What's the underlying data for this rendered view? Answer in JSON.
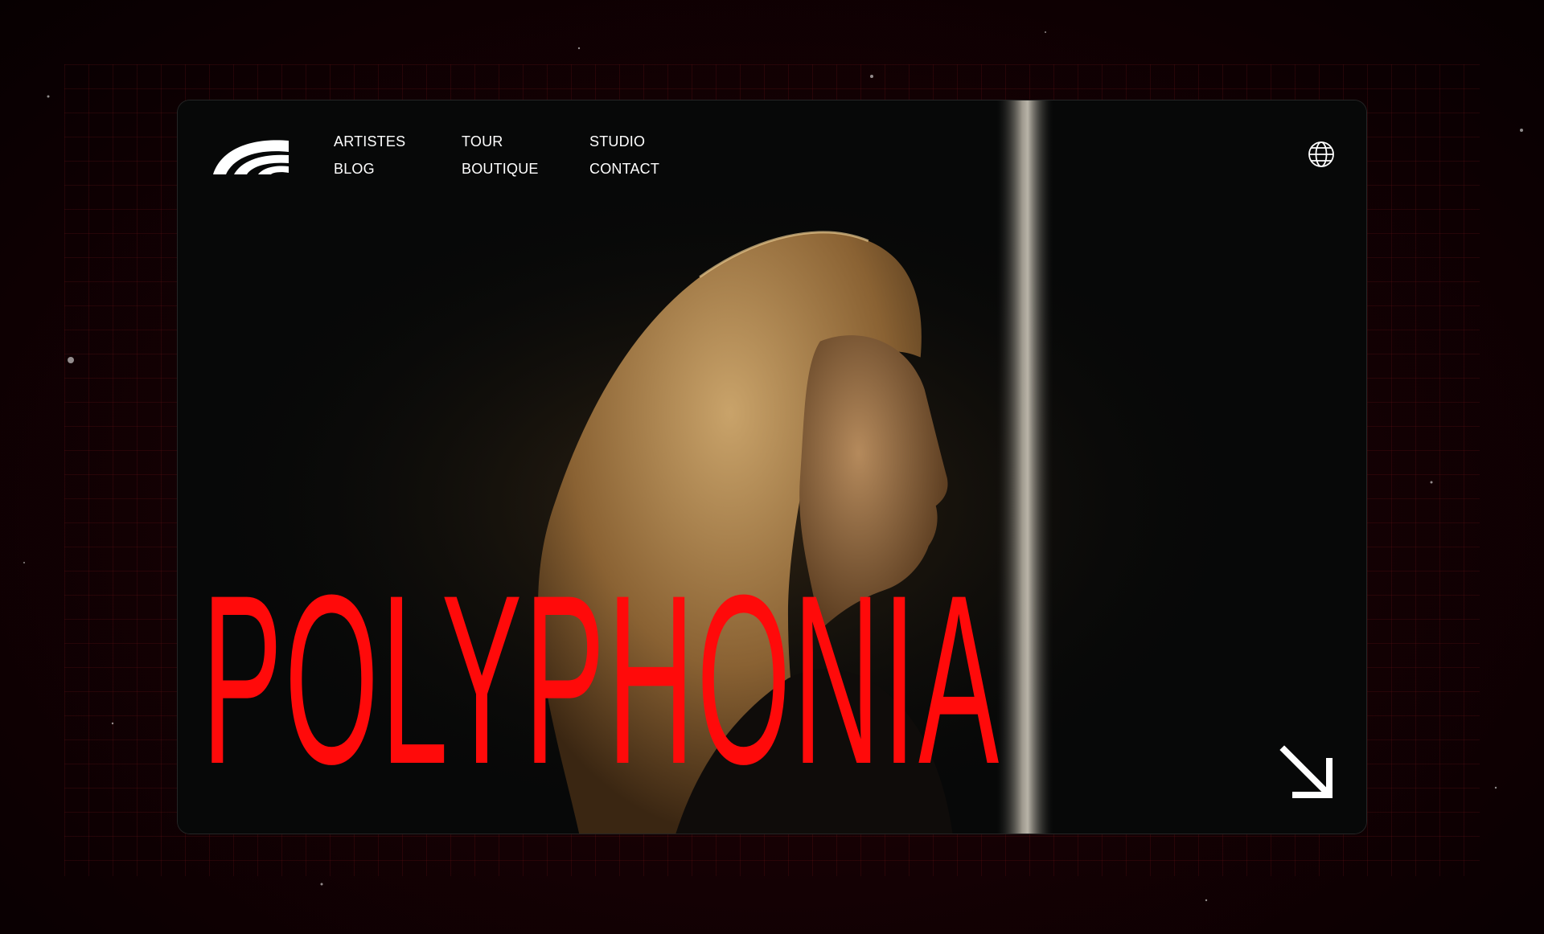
{
  "nav": {
    "links": [
      "ARTISTES",
      "TOUR",
      "STUDIO",
      "BLOG",
      "BOUTIQUE",
      "CONTACT"
    ]
  },
  "hero": {
    "title": "POLYPHONIA"
  },
  "icons": {
    "logo": "brand-arcs-logo",
    "language": "globe-icon",
    "cta": "arrow-down-right-icon"
  },
  "colors": {
    "accent": "#ff0a0a",
    "background": "#160104",
    "text": "#ffffff"
  }
}
